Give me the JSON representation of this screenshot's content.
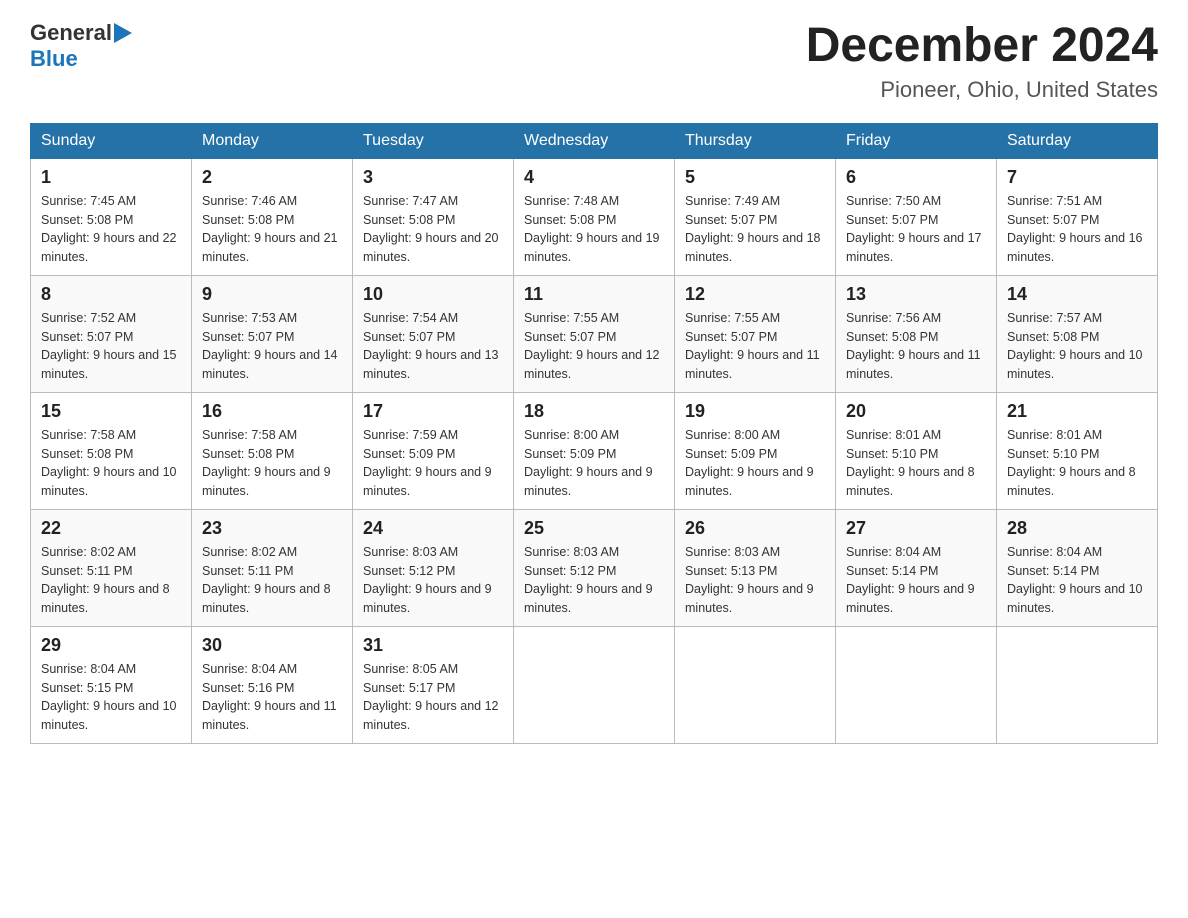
{
  "logo": {
    "text_general": "General",
    "text_blue": "Blue",
    "arrow_unicode": "▶"
  },
  "title": "December 2024",
  "location": "Pioneer, Ohio, United States",
  "days_of_week": [
    "Sunday",
    "Monday",
    "Tuesday",
    "Wednesday",
    "Thursday",
    "Friday",
    "Saturday"
  ],
  "weeks": [
    [
      {
        "day": "1",
        "sunrise": "7:45 AM",
        "sunset": "5:08 PM",
        "daylight": "9 hours and 22 minutes."
      },
      {
        "day": "2",
        "sunrise": "7:46 AM",
        "sunset": "5:08 PM",
        "daylight": "9 hours and 21 minutes."
      },
      {
        "day": "3",
        "sunrise": "7:47 AM",
        "sunset": "5:08 PM",
        "daylight": "9 hours and 20 minutes."
      },
      {
        "day": "4",
        "sunrise": "7:48 AM",
        "sunset": "5:08 PM",
        "daylight": "9 hours and 19 minutes."
      },
      {
        "day": "5",
        "sunrise": "7:49 AM",
        "sunset": "5:07 PM",
        "daylight": "9 hours and 18 minutes."
      },
      {
        "day": "6",
        "sunrise": "7:50 AM",
        "sunset": "5:07 PM",
        "daylight": "9 hours and 17 minutes."
      },
      {
        "day": "7",
        "sunrise": "7:51 AM",
        "sunset": "5:07 PM",
        "daylight": "9 hours and 16 minutes."
      }
    ],
    [
      {
        "day": "8",
        "sunrise": "7:52 AM",
        "sunset": "5:07 PM",
        "daylight": "9 hours and 15 minutes."
      },
      {
        "day": "9",
        "sunrise": "7:53 AM",
        "sunset": "5:07 PM",
        "daylight": "9 hours and 14 minutes."
      },
      {
        "day": "10",
        "sunrise": "7:54 AM",
        "sunset": "5:07 PM",
        "daylight": "9 hours and 13 minutes."
      },
      {
        "day": "11",
        "sunrise": "7:55 AM",
        "sunset": "5:07 PM",
        "daylight": "9 hours and 12 minutes."
      },
      {
        "day": "12",
        "sunrise": "7:55 AM",
        "sunset": "5:07 PM",
        "daylight": "9 hours and 11 minutes."
      },
      {
        "day": "13",
        "sunrise": "7:56 AM",
        "sunset": "5:08 PM",
        "daylight": "9 hours and 11 minutes."
      },
      {
        "day": "14",
        "sunrise": "7:57 AM",
        "sunset": "5:08 PM",
        "daylight": "9 hours and 10 minutes."
      }
    ],
    [
      {
        "day": "15",
        "sunrise": "7:58 AM",
        "sunset": "5:08 PM",
        "daylight": "9 hours and 10 minutes."
      },
      {
        "day": "16",
        "sunrise": "7:58 AM",
        "sunset": "5:08 PM",
        "daylight": "9 hours and 9 minutes."
      },
      {
        "day": "17",
        "sunrise": "7:59 AM",
        "sunset": "5:09 PM",
        "daylight": "9 hours and 9 minutes."
      },
      {
        "day": "18",
        "sunrise": "8:00 AM",
        "sunset": "5:09 PM",
        "daylight": "9 hours and 9 minutes."
      },
      {
        "day": "19",
        "sunrise": "8:00 AM",
        "sunset": "5:09 PM",
        "daylight": "9 hours and 9 minutes."
      },
      {
        "day": "20",
        "sunrise": "8:01 AM",
        "sunset": "5:10 PM",
        "daylight": "9 hours and 8 minutes."
      },
      {
        "day": "21",
        "sunrise": "8:01 AM",
        "sunset": "5:10 PM",
        "daylight": "9 hours and 8 minutes."
      }
    ],
    [
      {
        "day": "22",
        "sunrise": "8:02 AM",
        "sunset": "5:11 PM",
        "daylight": "9 hours and 8 minutes."
      },
      {
        "day": "23",
        "sunrise": "8:02 AM",
        "sunset": "5:11 PM",
        "daylight": "9 hours and 8 minutes."
      },
      {
        "day": "24",
        "sunrise": "8:03 AM",
        "sunset": "5:12 PM",
        "daylight": "9 hours and 9 minutes."
      },
      {
        "day": "25",
        "sunrise": "8:03 AM",
        "sunset": "5:12 PM",
        "daylight": "9 hours and 9 minutes."
      },
      {
        "day": "26",
        "sunrise": "8:03 AM",
        "sunset": "5:13 PM",
        "daylight": "9 hours and 9 minutes."
      },
      {
        "day": "27",
        "sunrise": "8:04 AM",
        "sunset": "5:14 PM",
        "daylight": "9 hours and 9 minutes."
      },
      {
        "day": "28",
        "sunrise": "8:04 AM",
        "sunset": "5:14 PM",
        "daylight": "9 hours and 10 minutes."
      }
    ],
    [
      {
        "day": "29",
        "sunrise": "8:04 AM",
        "sunset": "5:15 PM",
        "daylight": "9 hours and 10 minutes."
      },
      {
        "day": "30",
        "sunrise": "8:04 AM",
        "sunset": "5:16 PM",
        "daylight": "9 hours and 11 minutes."
      },
      {
        "day": "31",
        "sunrise": "8:05 AM",
        "sunset": "5:17 PM",
        "daylight": "9 hours and 12 minutes."
      },
      null,
      null,
      null,
      null
    ]
  ]
}
